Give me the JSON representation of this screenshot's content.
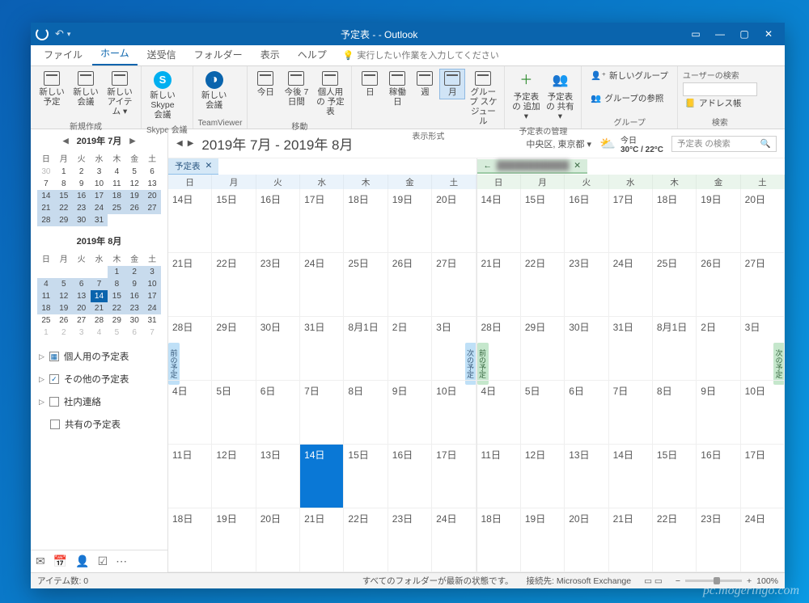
{
  "window": {
    "title": "予定表 -                         - Outlook",
    "buttons": {
      "ribbon_mode": "▭",
      "min": "—",
      "max": "▢",
      "close": "✕"
    }
  },
  "tabs": {
    "file": "ファイル",
    "home": "ホーム",
    "sendrecv": "送受信",
    "folder": "フォルダー",
    "view": "表示",
    "help": "ヘルプ",
    "tell_me": "実行したい作業を入力してください"
  },
  "ribbon": {
    "new": {
      "label": "新規作成",
      "appt": "新しい\n予定",
      "meeting": "新しい\n会議",
      "items": "新しい\nアイテム ▾"
    },
    "skype": {
      "label": "Skype 会議",
      "btn": "新しい\nSkype 会議"
    },
    "teamviewer": {
      "label": "TeamViewer",
      "btn": "新しい\n会議"
    },
    "move": {
      "label": "移動",
      "today": "今日",
      "next7": "今後\n7 日間",
      "personal": "個人用の\n予定表"
    },
    "arrange": {
      "label": "表示形式",
      "day": "日",
      "work": "稼働日",
      "week": "週",
      "month": "月",
      "group_sched": "グループ\nスケジュール"
    },
    "manage": {
      "label": "予定表の管理",
      "add": "予定表の\n追加 ▾",
      "share": "予定表の\n共有 ▾"
    },
    "groups": {
      "label": "グループ",
      "new_group": "新しいグループ",
      "browse": "グループの参照"
    },
    "search": {
      "label": "検索",
      "user_search_label": "ユーザーの検索",
      "addr": "アドレス帳",
      "placeholder": ""
    }
  },
  "main_header": {
    "range": "2019年 7月 - 2019年 8月",
    "location": "中央区, 東京都 ▾",
    "weather_label": "今日",
    "weather_temp": "30°C / 22°C",
    "search_placeholder": "予定表 の検索"
  },
  "sidebar": {
    "cal_items": {
      "personal": "個人用の予定表",
      "other": "その他の予定表",
      "internal": "社内連絡",
      "shared": "共有の予定表"
    },
    "other_checked": true
  },
  "minical1": {
    "title": "2019年 7月",
    "dow": [
      "日",
      "月",
      "火",
      "水",
      "木",
      "金",
      "土"
    ],
    "days": [
      {
        "t": "30",
        "dim": 1
      },
      {
        "t": "1"
      },
      {
        "t": "2"
      },
      {
        "t": "3"
      },
      {
        "t": "4"
      },
      {
        "t": "5"
      },
      {
        "t": "6"
      },
      {
        "t": "7"
      },
      {
        "t": "8"
      },
      {
        "t": "9"
      },
      {
        "t": "10"
      },
      {
        "t": "11"
      },
      {
        "t": "12"
      },
      {
        "t": "13"
      },
      {
        "t": "14",
        "hl": 1
      },
      {
        "t": "15",
        "hl": 1
      },
      {
        "t": "16",
        "hl": 1
      },
      {
        "t": "17",
        "hl": 1
      },
      {
        "t": "18",
        "hl": 1
      },
      {
        "t": "19",
        "hl": 1
      },
      {
        "t": "20",
        "hl": 1
      },
      {
        "t": "21",
        "hl": 1
      },
      {
        "t": "22",
        "hl": 1
      },
      {
        "t": "23",
        "hl": 1
      },
      {
        "t": "24",
        "hl": 1
      },
      {
        "t": "25",
        "hl": 1
      },
      {
        "t": "26",
        "hl": 1
      },
      {
        "t": "27",
        "hl": 1
      },
      {
        "t": "28",
        "hl": 1
      },
      {
        "t": "29",
        "hl": 1
      },
      {
        "t": "30",
        "hl": 1
      },
      {
        "t": "31",
        "hl": 1
      }
    ]
  },
  "minical2": {
    "title": "2019年 8月",
    "dow": [
      "日",
      "月",
      "火",
      "水",
      "木",
      "金",
      "土"
    ],
    "days": [
      {
        "t": ""
      },
      {
        "t": ""
      },
      {
        "t": ""
      },
      {
        "t": ""
      },
      {
        "t": "1",
        "hl": 1
      },
      {
        "t": "2",
        "hl": 1
      },
      {
        "t": "3",
        "hl": 1
      },
      {
        "t": "4",
        "hl": 1
      },
      {
        "t": "5",
        "hl": 1
      },
      {
        "t": "6",
        "hl": 1
      },
      {
        "t": "7",
        "hl": 1
      },
      {
        "t": "8",
        "hl": 1
      },
      {
        "t": "9",
        "hl": 1
      },
      {
        "t": "10",
        "hl": 1
      },
      {
        "t": "11",
        "hl": 1
      },
      {
        "t": "12",
        "hl": 1
      },
      {
        "t": "13",
        "hl": 1
      },
      {
        "t": "14",
        "today": 1
      },
      {
        "t": "15",
        "hl": 1
      },
      {
        "t": "16",
        "hl": 1
      },
      {
        "t": "17",
        "hl": 1
      },
      {
        "t": "18",
        "hl": 1
      },
      {
        "t": "19",
        "hl": 1
      },
      {
        "t": "20",
        "hl": 1
      },
      {
        "t": "21",
        "hl": 1
      },
      {
        "t": "22",
        "hl": 1
      },
      {
        "t": "23",
        "hl": 1
      },
      {
        "t": "24",
        "hl": 1
      },
      {
        "t": "25"
      },
      {
        "t": "26"
      },
      {
        "t": "27"
      },
      {
        "t": "28"
      },
      {
        "t": "29"
      },
      {
        "t": "30"
      },
      {
        "t": "31"
      },
      {
        "t": "1",
        "dim": 1
      },
      {
        "t": "2",
        "dim": 1
      },
      {
        "t": "3",
        "dim": 1
      },
      {
        "t": "4",
        "dim": 1
      },
      {
        "t": "5",
        "dim": 1
      },
      {
        "t": "6",
        "dim": 1
      },
      {
        "t": "7",
        "dim": 1
      }
    ]
  },
  "calendar": {
    "tab1": "予定表",
    "dow": [
      "日",
      "月",
      "火",
      "水",
      "木",
      "金",
      "土"
    ],
    "weeks": [
      [
        "14日",
        "15日",
        "16日",
        "17日",
        "18日",
        "19日",
        "20日"
      ],
      [
        "21日",
        "22日",
        "23日",
        "24日",
        "25日",
        "26日",
        "27日"
      ],
      [
        "28日",
        "29日",
        "30日",
        "31日",
        "8月1日",
        "2日",
        "3日"
      ],
      [
        "4日",
        "5日",
        "6日",
        "7日",
        "8日",
        "9日",
        "10日"
      ],
      [
        "11日",
        "12日",
        "13日",
        "14日",
        "15日",
        "16日",
        "17日"
      ],
      [
        "18日",
        "19日",
        "20日",
        "21日",
        "22日",
        "23日",
        "24日"
      ]
    ],
    "today_row": 4,
    "today_col": 3,
    "prev_label": "前の予定",
    "next_label": "次の予定"
  },
  "status": {
    "items": "アイテム数: 0",
    "sync": "すべてのフォルダーが最新の状態です。",
    "conn": "接続先: Microsoft Exchange",
    "zoom": "100%"
  },
  "watermark": "pc.mogeringo.com"
}
